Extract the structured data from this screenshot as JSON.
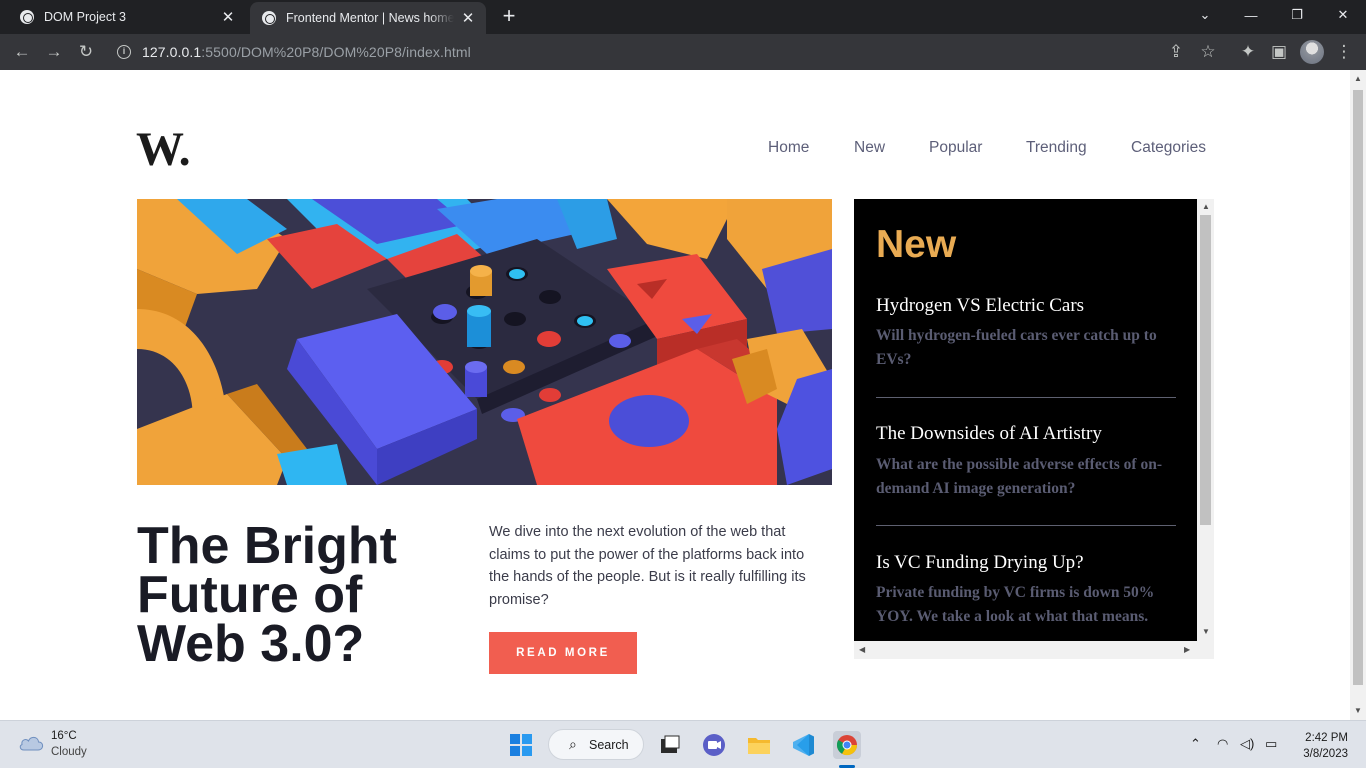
{
  "browser": {
    "tabs": [
      {
        "title": "DOM Project 3",
        "active": false
      },
      {
        "title": "Frontend Mentor | News homepage",
        "active": true
      }
    ],
    "url_host": "127.0.0.1",
    "url_rest": ":5500/DOM%20P8/DOM%20P8/index.html"
  },
  "site": {
    "logo": "W.",
    "nav": [
      "Home",
      "New",
      "Popular",
      "Trending",
      "Categories"
    ],
    "hero": {
      "headline_lines": [
        "The Bright",
        "Future of",
        "Web 3.0?"
      ],
      "description": "We dive into the next evolution of the web that claims to put the power of the platforms back into the hands of the people. But is it really fulfilling its promise?",
      "cta": "READ MORE"
    },
    "sidebar": {
      "title": "New",
      "items": [
        {
          "title": "Hydrogen VS Electric Cars",
          "desc": "Will hydrogen-fueled cars ever catch up to EVs?"
        },
        {
          "title": "The Downsides of AI Artistry",
          "desc": "What are the possible adverse effects of on-demand AI image generation?"
        },
        {
          "title": "Is VC Funding Drying Up?",
          "desc": "Private funding by VC firms is down 50% YOY. We take a look at what that means."
        }
      ]
    }
  },
  "taskbar": {
    "weather_temp": "16°C",
    "weather_cond": "Cloudy",
    "search_label": "Search",
    "time": "2:42 PM",
    "date": "3/8/2023"
  },
  "colors": {
    "accent_orange": "#e9ab53",
    "cta_red": "#f15e50",
    "dark_text": "#1a1b25",
    "sidebar_bg": "#000000"
  }
}
